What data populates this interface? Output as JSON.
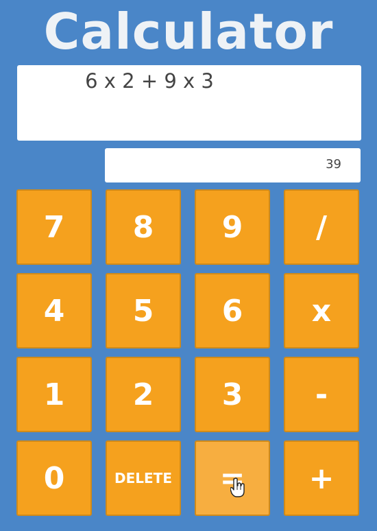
{
  "app": {
    "title": "Calculator"
  },
  "display": {
    "expression": "6 x 2 + 9 x 3",
    "result": "39"
  },
  "keys": [
    {
      "label": "7",
      "name": "key-7"
    },
    {
      "label": "8",
      "name": "key-8"
    },
    {
      "label": "9",
      "name": "key-9"
    },
    {
      "label": "/",
      "name": "key-divide"
    },
    {
      "label": "4",
      "name": "key-4"
    },
    {
      "label": "5",
      "name": "key-5"
    },
    {
      "label": "6",
      "name": "key-6"
    },
    {
      "label": "x",
      "name": "key-multiply"
    },
    {
      "label": "1",
      "name": "key-1"
    },
    {
      "label": "2",
      "name": "key-2"
    },
    {
      "label": "3",
      "name": "key-3"
    },
    {
      "label": "-",
      "name": "key-subtract"
    },
    {
      "label": "0",
      "name": "key-0"
    },
    {
      "label": "DELETE",
      "name": "delete-button"
    },
    {
      "label": "=",
      "name": "equals-button"
    },
    {
      "label": "+",
      "name": "key-add"
    }
  ],
  "colors": {
    "background": "#4a86c8",
    "key": "#f5a11e",
    "key_text": "#ffffff",
    "display": "#ffffff"
  },
  "cursor": {
    "icon": "hand-pointer-icon",
    "over": "equals-button"
  }
}
